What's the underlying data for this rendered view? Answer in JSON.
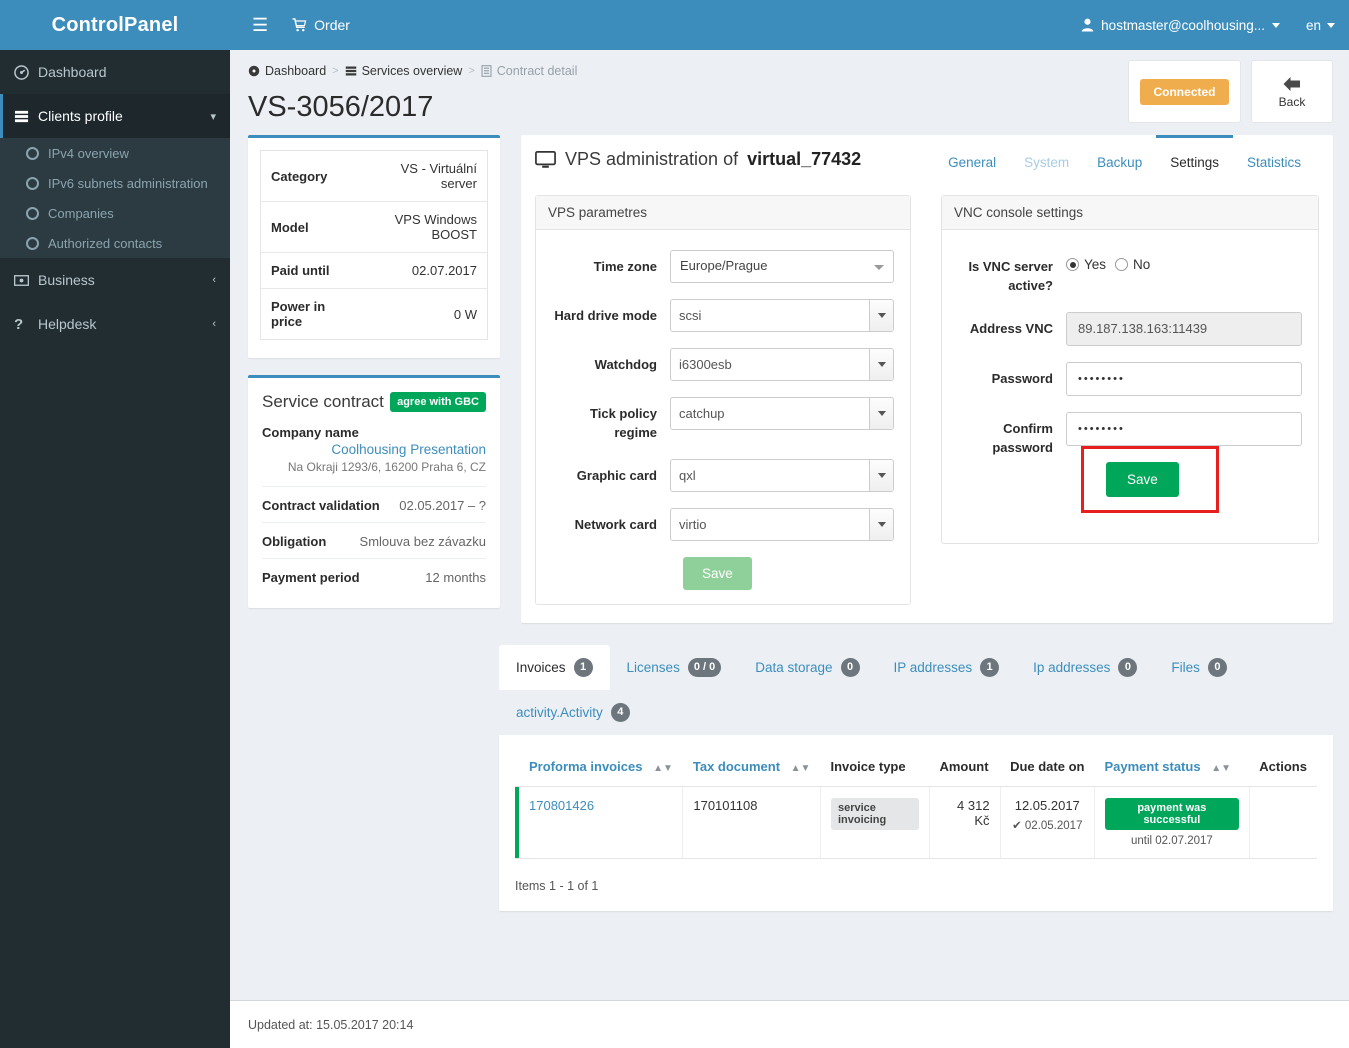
{
  "brand": {
    "title": "ControlPanel"
  },
  "topbar": {
    "order_label": "Order",
    "user_label": "hostmaster@coolhousing...",
    "lang_label": "en"
  },
  "sidebar": {
    "items": [
      {
        "label": "Dashboard",
        "icon": "dashboard-icon"
      },
      {
        "label": "Clients profile",
        "icon": "clients-icon",
        "active": true,
        "caret": "⌄"
      },
      {
        "label": "Business",
        "icon": "business-icon",
        "caret": "‹"
      },
      {
        "label": "Helpdesk",
        "icon": "help-icon",
        "caret": "‹"
      }
    ],
    "submenu": [
      {
        "label": "IPv4 overview"
      },
      {
        "label": "IPv6 subnets administration"
      },
      {
        "label": "Companies"
      },
      {
        "label": "Authorized contacts"
      }
    ]
  },
  "breadcrumb": [
    {
      "label": "Dashboard",
      "icon": "dashboard-icon"
    },
    {
      "label": "Services overview",
      "icon": "services-icon"
    },
    {
      "label": "Contract detail",
      "icon": "contract-icon",
      "muted": true
    }
  ],
  "page": {
    "title": "VS-3056/2017"
  },
  "head_actions": {
    "status_badge": "Connected",
    "back_label": "Back"
  },
  "info_card": {
    "rows": [
      {
        "k": "Category",
        "v": "VS - Virtuální server"
      },
      {
        "k": "Model",
        "v": "VPS Windows BOOST"
      },
      {
        "k": "Paid until",
        "v": "02.07.2017"
      },
      {
        "k": "Power in price",
        "v": "0 W"
      }
    ]
  },
  "contract_card": {
    "title": "Service contract",
    "gbc_badge": "agree with GBC",
    "company_label": "Company name",
    "company_name": "Coolhousing Presentation",
    "company_address": "Na Okraji 1293/6, 16200 Praha 6, CZ",
    "rows": [
      {
        "k": "Contract validation",
        "v": "02.05.2017 – ?"
      },
      {
        "k": "Obligation",
        "v": "Smlouva bez závazku"
      },
      {
        "k": "Payment period",
        "v": "12 months"
      }
    ]
  },
  "vps": {
    "title_prefix": "VPS administration of ",
    "title_name": "virtual_77432",
    "tabs": [
      {
        "label": "General",
        "state": "link"
      },
      {
        "label": "System",
        "state": "disabled"
      },
      {
        "label": "Backup",
        "state": "link"
      },
      {
        "label": "Settings",
        "state": "active"
      },
      {
        "label": "Statistics",
        "state": "link"
      }
    ],
    "parametres": {
      "panel_title": "VPS parametres",
      "fields": [
        {
          "label": "Time zone",
          "value": "Europe/Prague",
          "type": "select2"
        },
        {
          "label": "Hard drive mode",
          "value": "scsi",
          "type": "select"
        },
        {
          "label": "Watchdog",
          "value": "i6300esb",
          "type": "select"
        },
        {
          "label": "Tick policy regime",
          "value": "catchup",
          "type": "select"
        },
        {
          "label": "Graphic card",
          "value": "qxl",
          "type": "select"
        },
        {
          "label": "Network card",
          "value": "virtio",
          "type": "select"
        }
      ],
      "save_label": "Save"
    },
    "vnc": {
      "panel_title": "VNC console settings",
      "active_label": "Is VNC server active?",
      "yes_label": "Yes",
      "no_label": "No",
      "address_label": "Address VNC",
      "address_value": "89.187.138.163:11439",
      "password_label": "Password",
      "password_value": "••••••••",
      "confirm_label": "Confirm password",
      "confirm_value": "••••••••",
      "save_label": "Save"
    }
  },
  "bottom_tabs": [
    {
      "label": "Invoices",
      "count": "1",
      "active": true
    },
    {
      "label": "Licenses",
      "count": "0 / 0"
    },
    {
      "label": "Data storage",
      "count": "0"
    },
    {
      "label": "IP addresses",
      "count": "1"
    },
    {
      "label": "Ip addresses",
      "count": "0"
    },
    {
      "label": "Files",
      "count": "0"
    },
    {
      "label": "activity.Activity",
      "count": "4"
    }
  ],
  "invoices_table": {
    "headers": [
      {
        "label": "Proforma invoices",
        "sortable": true,
        "link": true
      },
      {
        "label": "Tax document",
        "sortable": true,
        "link": true
      },
      {
        "label": "Invoice type",
        "sortable": false,
        "link": false
      },
      {
        "label": "Amount",
        "sortable": false,
        "link": false,
        "align": "right"
      },
      {
        "label": "Due date on",
        "sortable": false,
        "link": false,
        "align": "center"
      },
      {
        "label": "Payment status",
        "sortable": true,
        "link": true
      },
      {
        "label": "Actions",
        "sortable": false,
        "link": false
      }
    ],
    "rows": [
      {
        "proforma": "170801426",
        "tax_document": "170101108",
        "invoice_type": "service invoicing",
        "amount": "4 312 Kč",
        "due_date": "12.05.2017",
        "paid_date": "02.05.2017",
        "payment_status": "payment was successful",
        "payment_until": "until 02.07.2017",
        "actions": ""
      }
    ],
    "items_info": "Items 1 - 1 of 1"
  },
  "footer": {
    "updated": "Updated at: 15.05.2017 20:14"
  },
  "colors": {
    "brand_blue": "#3c8dbc",
    "sidebar_dark": "#222d32",
    "green": "#00a65a",
    "orange": "#f0ad4e",
    "red_highlight": "#e81f1f"
  }
}
